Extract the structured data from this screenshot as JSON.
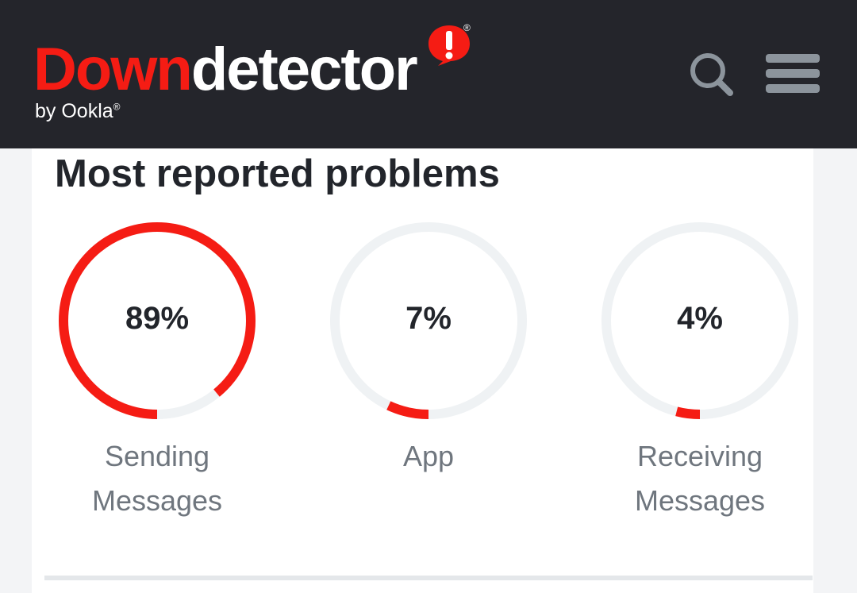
{
  "header": {
    "logo_primary": "Down",
    "logo_secondary": "detector",
    "logo_by": "by Ookla",
    "logo_by_mark": "®",
    "logo_mark": "®",
    "search_icon": "search-icon",
    "menu_icon": "hamburger-menu-icon",
    "background_color": "#24252b",
    "brand_color": "#f51c14"
  },
  "section": {
    "title": "Most reported problems"
  },
  "problems": [
    {
      "percent": 89,
      "percent_label": "89%",
      "label": "Sending Messages"
    },
    {
      "percent": 7,
      "percent_label": "7%",
      "label": "App"
    },
    {
      "percent": 4,
      "percent_label": "4%",
      "label": "Receiving Messages"
    }
  ],
  "ring_colors": {
    "fill": "#f51c14",
    "track": "#eff2f4"
  }
}
